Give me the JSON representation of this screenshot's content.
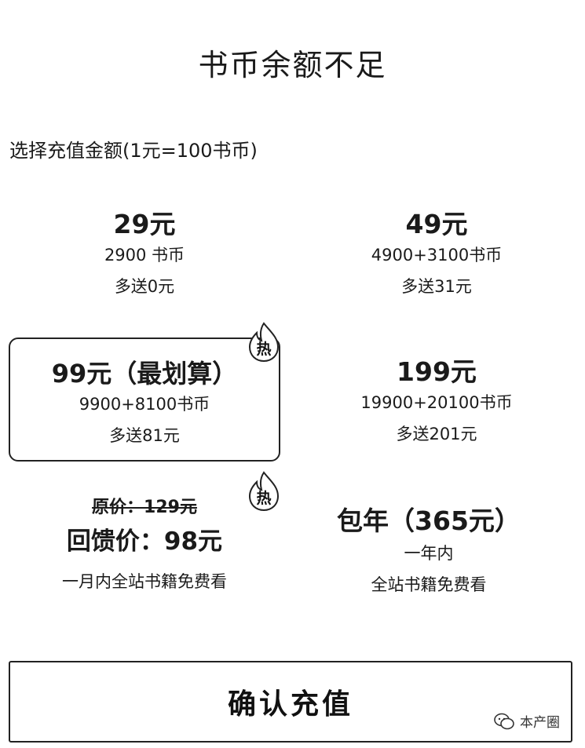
{
  "header": {
    "title": "书币余额不足",
    "subtitle": "选择充值金额(1元=100书币)"
  },
  "options": [
    {
      "price": "29元",
      "coins": "2900 书币",
      "bonus": "多送0元"
    },
    {
      "price": "49元",
      "coins": "4900+3100书币",
      "bonus": "多送31元"
    },
    {
      "price": "99元（最划算）",
      "coins": "9900+8100书币",
      "bonus": "多送81元",
      "hot_icon": "fire-hot-icon",
      "hot_text": "热"
    },
    {
      "price": "199元",
      "coins": "19900+20100书币",
      "bonus": "多送201元"
    },
    {
      "original": "原价：129元",
      "sale": "回馈价：98元",
      "desc": "一月内全站书籍免费看",
      "hot_icon": "fire-hot-icon",
      "hot_text": "热"
    },
    {
      "price": "包年（365元）",
      "line1": "一年内",
      "line2": "全站书籍免费看"
    }
  ],
  "confirm": {
    "label": "确认充值"
  },
  "watermark": {
    "icon": "wechat-icon",
    "text": "本产圈"
  },
  "colors": {
    "border": "#222222",
    "text": "#1a1a1a",
    "background": "#ffffff"
  }
}
